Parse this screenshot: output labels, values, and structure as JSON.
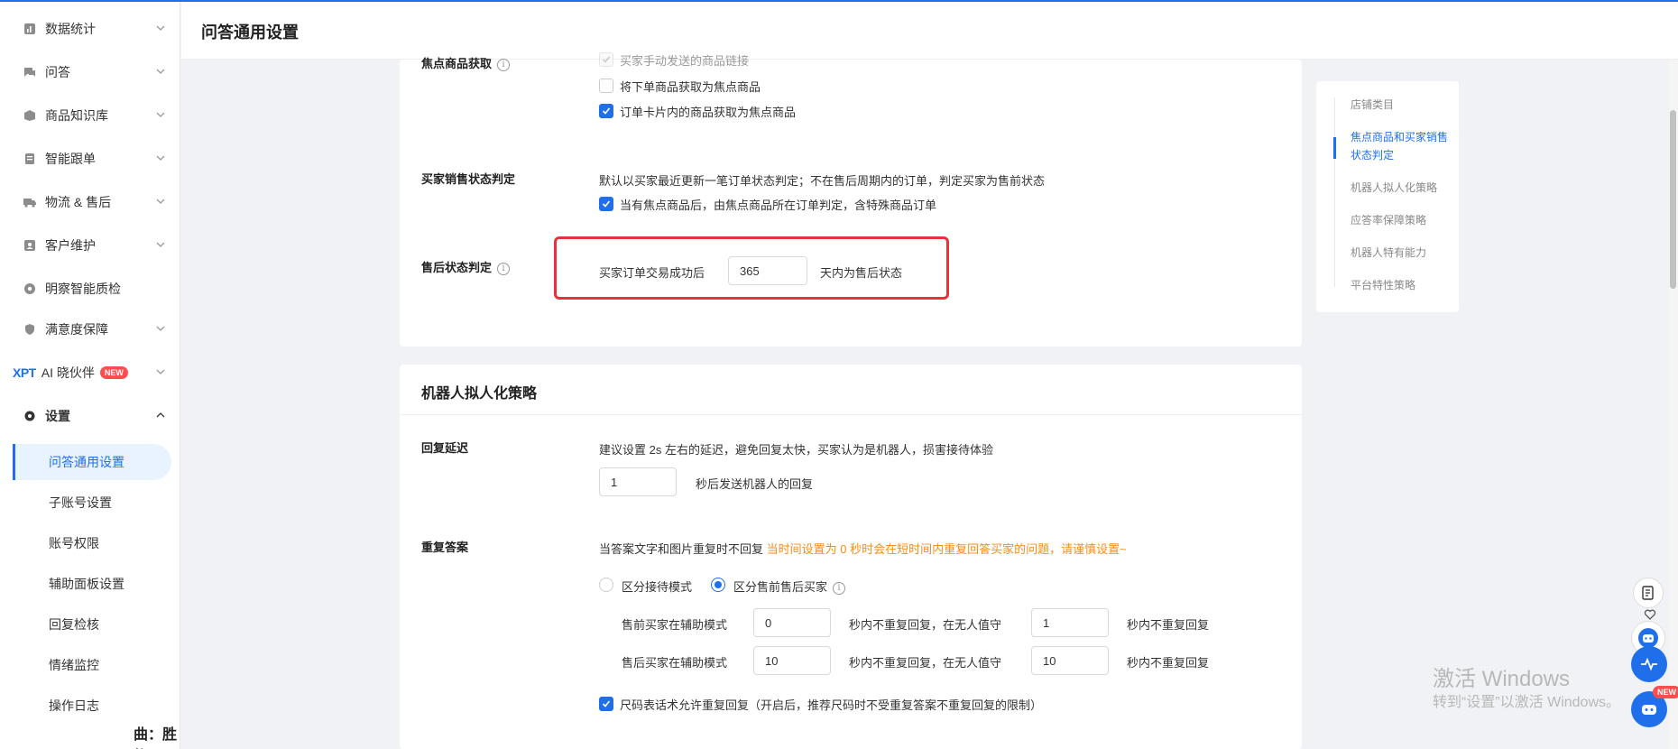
{
  "sidebar": {
    "items": [
      {
        "label": "数据统计",
        "icon": "chart-icon"
      },
      {
        "label": "问答",
        "icon": "chat-icon"
      },
      {
        "label": "商品知识库",
        "icon": "box-icon"
      },
      {
        "label": "智能跟单",
        "icon": "document-icon"
      },
      {
        "label": "物流 & 售后",
        "icon": "truck-icon"
      },
      {
        "label": "客户维护",
        "icon": "customer-icon"
      },
      {
        "label": "明察智能质检",
        "icon": "inspect-icon"
      },
      {
        "label": "满意度保障",
        "icon": "shield-icon"
      }
    ],
    "ai": {
      "brand": "XPT",
      "label": "AI 晓伙伴",
      "badge": "NEW"
    },
    "settings": {
      "label": "设置",
      "icon": "gear-icon"
    },
    "sub_items": [
      "问答通用设置",
      "子账号设置",
      "账号权限",
      "辅助面板设置",
      "回复检核",
      "情绪监控",
      "操作日志"
    ],
    "footer": "曲：胜屿"
  },
  "header": {
    "title": "问答通用设置"
  },
  "focus": {
    "label": "焦点商品获取",
    "opt_cut": "买家手动发送的商品链接",
    "opt1": "将下单商品获取为焦点商品",
    "opt2": "订单卡片内的商品获取为焦点商品"
  },
  "buyer_status": {
    "label": "买家销售状态判定",
    "desc": "默认以买家最近更新一笔订单状态判定；不在售后周期内的订单，判定买家为售前状态",
    "opt": "当有焦点商品后，由焦点商品所在订单判定，含特殊商品订单"
  },
  "aftersale": {
    "label": "售后状态判定",
    "prefix": "买家订单交易成功后",
    "days": "365",
    "suffix": "天内为售后状态"
  },
  "robot": {
    "title": "机器人拟人化策略",
    "delay": {
      "label": "回复延迟",
      "desc": "建议设置 2s 左右的延迟，避免回复太快，买家认为是机器人，损害接待体验",
      "value": "1",
      "suffix": "秒后发送机器人的回复"
    },
    "repeat": {
      "label": "重复答案",
      "desc": "当答案文字和图片重复时不回复",
      "warning": "当时间设置为 0 秒时会在短时间内重复回答买家的问题，请谨慎设置~",
      "mode1": "区分接待模式",
      "mode2": "区分售前售后买家",
      "pre_label": "售前买家在辅助模式",
      "pre_assist": "0",
      "mid": "秒内不重复回复，在无人值守",
      "pre_unattended": "1",
      "tail": "秒内不重复回复",
      "post_label": "售后买家在辅助模式",
      "post_assist": "10",
      "post_unattended": "10",
      "size_opt": "尺码表话术允许重复回复（开启后，推荐尺码时不受重复答案不重复回复的限制）"
    }
  },
  "anchor_nav": [
    "店铺类目",
    "焦点商品和买家销售状态判定",
    "机器人拟人化策略",
    "应答率保障策略",
    "机器人特有能力",
    "平台特性策略"
  ],
  "watermark": {
    "line1": "激活 Windows",
    "line2": "转到“设置”以激活 Windows。"
  },
  "float": {
    "badge": "NEW"
  },
  "colors": {
    "accent": "#1f6feb",
    "warning": "#fa8c16",
    "highlight": "#e8313b",
    "badge": "#ff4d4f"
  }
}
